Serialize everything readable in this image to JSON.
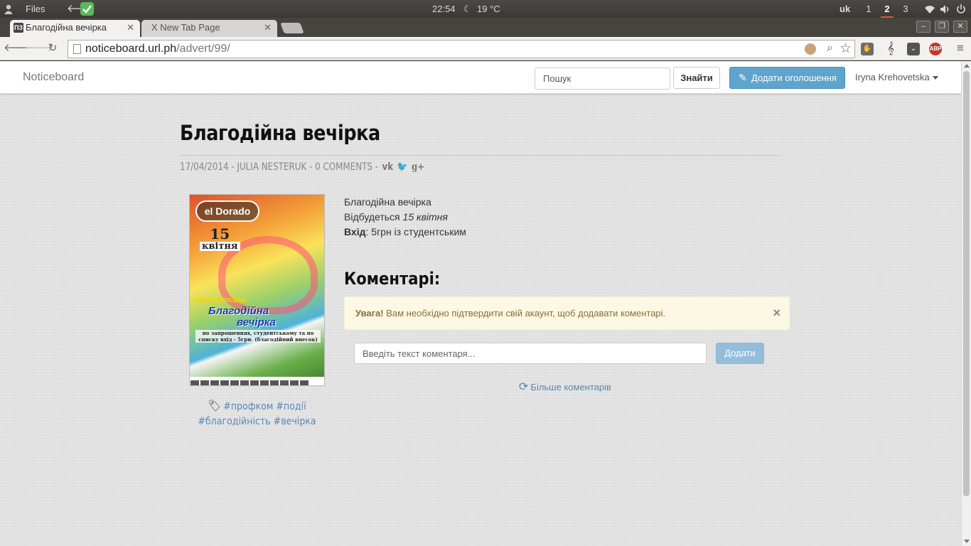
{
  "os_panel": {
    "files_label": "Files",
    "clock": "22:54",
    "weather": "19 °C",
    "keyboard_layout": "uk",
    "workspaces": [
      "1",
      "2",
      "3"
    ],
    "active_workspace": "2"
  },
  "browser": {
    "tabs": [
      {
        "title": "Благодійна вечірка",
        "favicon": "ПЗ",
        "active": true
      },
      {
        "title": "New Tab Page",
        "favicon": "X",
        "active": false
      }
    ],
    "url_host": "noticeboard.url.ph",
    "url_path": "/advert/99/",
    "extensions": [
      "abp-icon"
    ],
    "abp_label": "ABP"
  },
  "navbar": {
    "brand": "Noticeboard",
    "search_placeholder": "Пошук",
    "search_button": "Знайти",
    "add_button": "Додати оголошення",
    "user_name": "Iryna Krehovetska"
  },
  "post": {
    "title": "Благодійна вечірка",
    "date": "17/04/2014",
    "author": "JULIA NESTERUK",
    "comments_count": "0 COMMENTS",
    "poster": {
      "logo": "el Dorado",
      "day": "15",
      "month": "квітня",
      "kicker": "студентська",
      "main_line1": "Благодійна",
      "main_line2": "вечірка",
      "small_text": "по запрошеннях, студентському та по списку вхід - 5грн. (благодійний внесок)"
    },
    "tags": [
      "#профком",
      "#події",
      "#благодійність",
      "#вечірка"
    ],
    "body": {
      "line1": "Благодійна вечірка",
      "line2_prefix": "Відбудеться ",
      "line2_italic": "15 квітня",
      "line3_bold": "Вхід",
      "line3_rest": ": 5грн із студентським"
    }
  },
  "comments": {
    "heading": "Коментарі:",
    "alert_bold": "Увага!",
    "alert_text": " Вам необхідно підтвердити свій акаунт, щоб додавати коментарі.",
    "input_placeholder": "Введіть текст коментаря...",
    "submit_button": "Додати",
    "more_link": "Більше коментарів"
  }
}
